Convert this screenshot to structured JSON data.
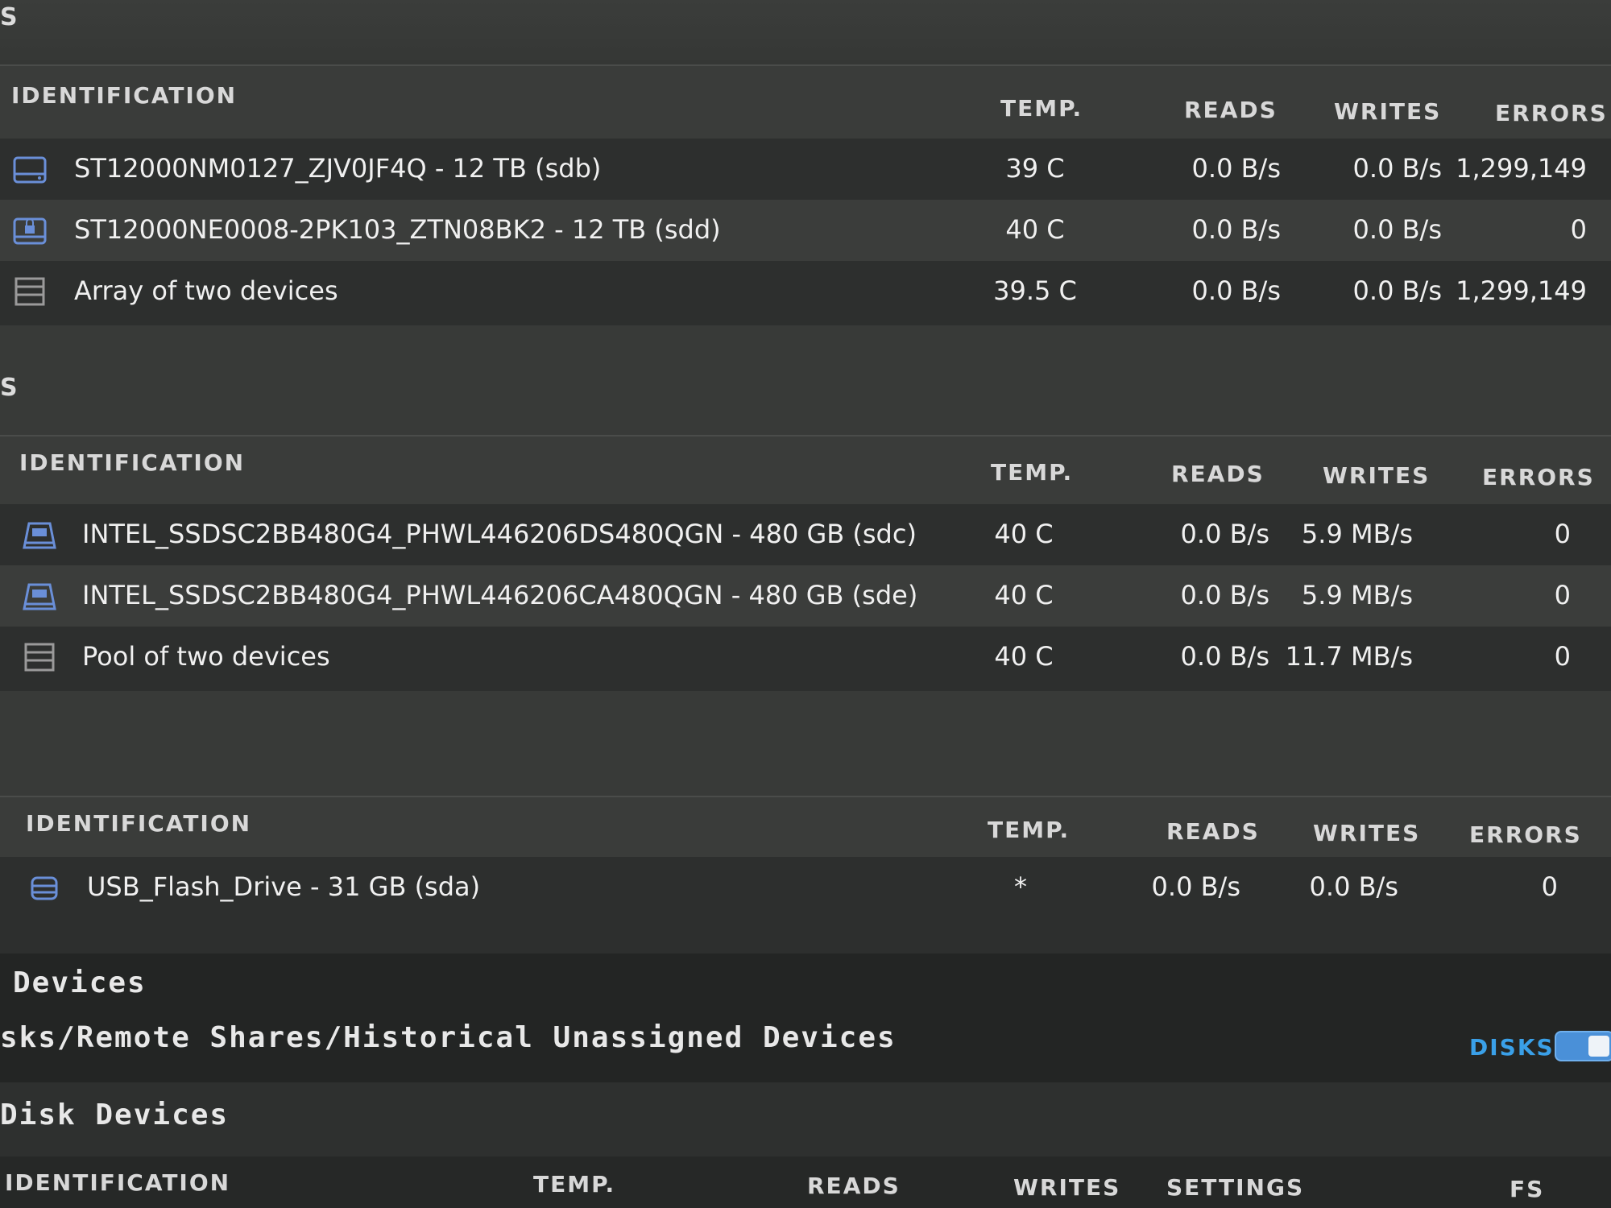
{
  "colors": {
    "accent": "#3aa0e8",
    "icon_blue": "#6a8fd8"
  },
  "sections": [
    {
      "cut_letter": "S",
      "headers": {
        "identification": "IDENTIFICATION",
        "temp": "TEMP.",
        "reads": "READS",
        "writes": "WRITES",
        "errors": "ERRORS"
      },
      "rows": [
        {
          "icon": "hdd-icon",
          "name": "ST12000NM0127_ZJV0JF4Q - 12 TB (sdb)",
          "temp": "39 C",
          "reads": "0.0 B/s",
          "writes": "0.0 B/s",
          "errors": "1,299,149"
        },
        {
          "icon": "hdd-lock-icon",
          "name": "ST12000NE0008-2PK103_ZTN08BK2 - 12 TB (sdd)",
          "temp": "40 C",
          "reads": "0.0 B/s",
          "writes": "0.0 B/s",
          "errors": "0"
        },
        {
          "icon": "array-icon",
          "name": "Array of two devices",
          "temp": "39.5 C",
          "reads": "0.0 B/s",
          "writes": "0.0 B/s",
          "errors": "1,299,149"
        }
      ]
    },
    {
      "cut_letter": "S",
      "headers": {
        "identification": "IDENTIFICATION",
        "temp": "TEMP.",
        "reads": "READS",
        "writes": "WRITES",
        "errors": "ERRORS"
      },
      "rows": [
        {
          "icon": "ssd-icon",
          "name": "INTEL_SSDSC2BB480G4_PHWL446206DS480QGN - 480 GB (sdc)",
          "temp": "40 C",
          "reads": "0.0 B/s",
          "writes": "5.9 MB/s",
          "errors": "0"
        },
        {
          "icon": "ssd-icon",
          "name": "INTEL_SSDSC2BB480G4_PHWL446206CA480QGN - 480 GB (sde)",
          "temp": "40 C",
          "reads": "0.0 B/s",
          "writes": "5.9 MB/s",
          "errors": "0"
        },
        {
          "icon": "pool-icon",
          "name": "Pool of two devices",
          "temp": "40 C",
          "reads": "0.0 B/s",
          "writes": "11.7 MB/s",
          "errors": "0"
        }
      ]
    },
    {
      "headers": {
        "identification": "IDENTIFICATION",
        "temp": "TEMP.",
        "reads": "READS",
        "writes": "WRITES",
        "errors": "ERRORS"
      },
      "rows": [
        {
          "icon": "usb-drive-icon",
          "name": "USB_Flash_Drive - 31 GB (sda)",
          "temp": "*",
          "reads": "0.0 B/s",
          "writes": "0.0 B/s",
          "errors": "0"
        }
      ]
    }
  ],
  "devices_title": "Devices",
  "unassigned_title": "sks/Remote Shares/Historical Unassigned Devices",
  "disks_toggle_label": "DISKS",
  "disk_devices_title": "Disk Devices",
  "bottom_headers": {
    "identification": "IDENTIFICATION",
    "temp": "TEMP.",
    "reads": "READS",
    "writes": "WRITES",
    "settings": "SETTINGS",
    "fs": "FS"
  }
}
